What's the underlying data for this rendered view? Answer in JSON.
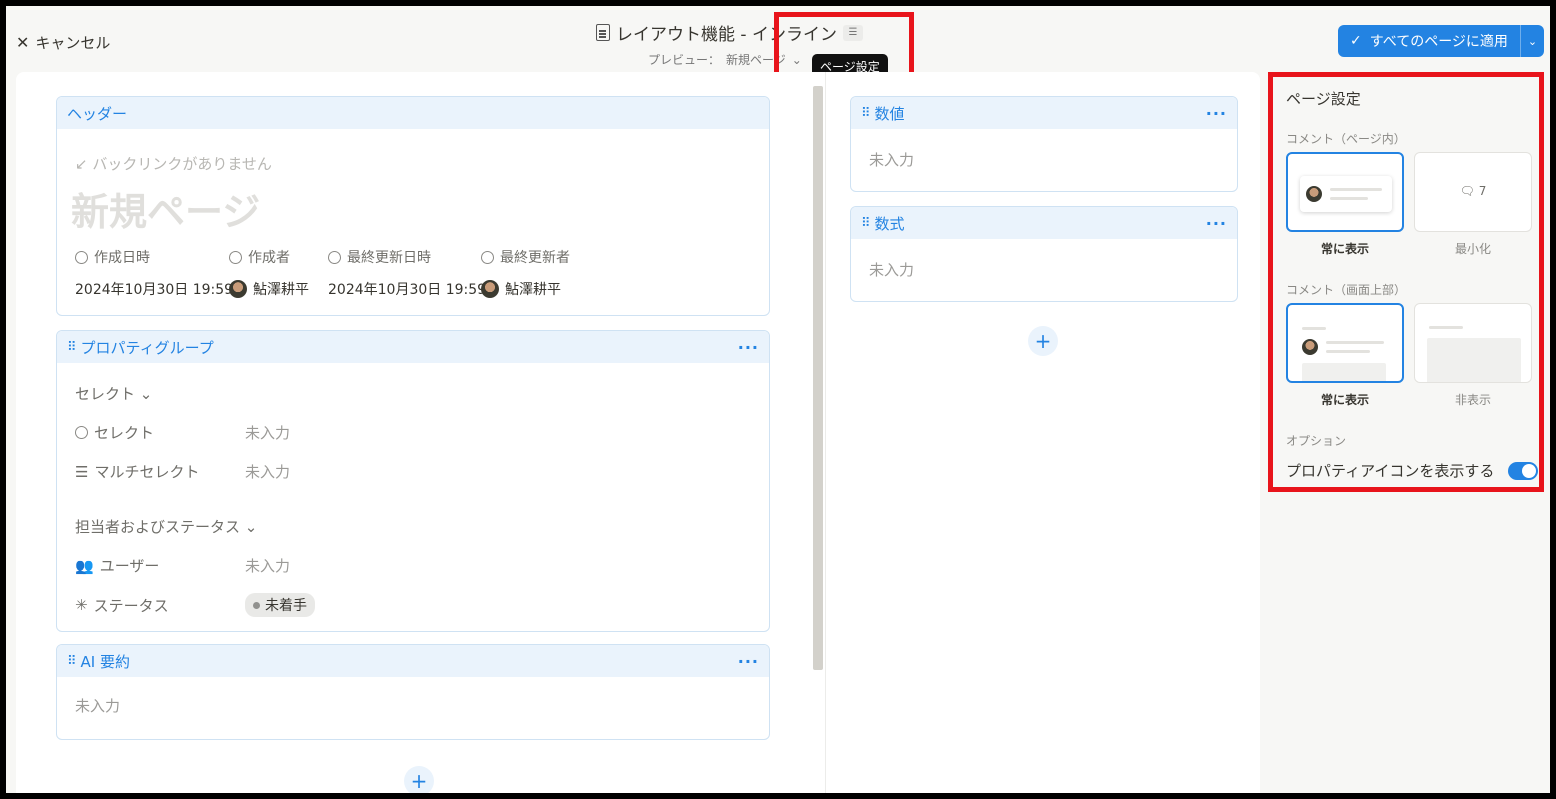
{
  "topbar": {
    "cancel_label": "キャンセル",
    "title": "レイアウト機能 - インライン",
    "preview_label": "プレビュー：",
    "preview_page": "新規ページ",
    "tooltip": "ページ設定",
    "apply_label": "すべてのページに適用"
  },
  "header_card": {
    "title": "ヘッダー",
    "backlink": "バックリンクがありません",
    "page_title": "新規ページ",
    "props": [
      {
        "label": "作成日時",
        "value": "2024年10月30日 19:59"
      },
      {
        "label": "作成者",
        "value": "鮎澤耕平"
      },
      {
        "label": "最終更新日時",
        "value": "2024年10月30日 19:59"
      },
      {
        "label": "最終更新者",
        "value": "鮎澤耕平"
      }
    ]
  },
  "group_card": {
    "title": "プロパティグループ",
    "group1_title": "セレクト",
    "group1_rows": [
      {
        "label": "セレクト",
        "value": "未入力"
      },
      {
        "label": "マルチセレクト",
        "value": "未入力"
      }
    ],
    "group2_title": "担当者およびステータス",
    "group2_rows": [
      {
        "label": "ユーザー",
        "value": "未入力"
      },
      {
        "label": "ステータス",
        "value": "未着手"
      }
    ]
  },
  "ai_card": {
    "title": "AI 要約",
    "value": "未入力"
  },
  "right_cards": [
    {
      "title": "数値",
      "value": "未入力"
    },
    {
      "title": "数式",
      "value": "未入力"
    }
  ],
  "panel": {
    "title": "ページ設定",
    "comment_inline_label": "コメント（ページ内）",
    "comment_inline_options": [
      {
        "caption": "常に表示",
        "selected": true
      },
      {
        "caption": "最小化",
        "selected": false,
        "count": "7"
      }
    ],
    "comment_top_label": "コメント（画面上部）",
    "comment_top_options": [
      {
        "caption": "常に表示",
        "selected": true
      },
      {
        "caption": "非表示",
        "selected": false
      }
    ],
    "options_label": "オプション",
    "show_icons_label": "プロパティアイコンを表示する",
    "show_icons_on": true
  },
  "colors": {
    "accent": "#2383e2",
    "highlight": "#e8141b"
  }
}
